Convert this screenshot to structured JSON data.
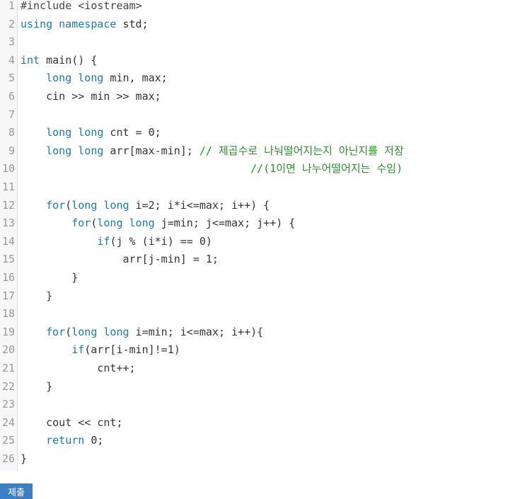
{
  "editor": {
    "lines": [
      {
        "n": "1",
        "segments": [
          {
            "t": "#include <iostream>",
            "c": "sub"
          }
        ]
      },
      {
        "n": "2",
        "segments": [
          {
            "t": "using namespace",
            "c": "kw"
          },
          {
            "t": " std;",
            "c": ""
          }
        ]
      },
      {
        "n": "3",
        "segments": []
      },
      {
        "n": "4",
        "segments": [
          {
            "t": "int",
            "c": "kw"
          },
          {
            "t": " main() {",
            "c": ""
          }
        ]
      },
      {
        "n": "5",
        "segments": [
          {
            "t": "    ",
            "c": ""
          },
          {
            "t": "long long",
            "c": "kw"
          },
          {
            "t": " min, max;",
            "c": ""
          }
        ]
      },
      {
        "n": "6",
        "segments": [
          {
            "t": "    cin >> min >> max;",
            "c": ""
          }
        ]
      },
      {
        "n": "7",
        "segments": []
      },
      {
        "n": "8",
        "segments": [
          {
            "t": "    ",
            "c": ""
          },
          {
            "t": "long long",
            "c": "kw"
          },
          {
            "t": " cnt = 0;",
            "c": ""
          }
        ]
      },
      {
        "n": "9",
        "segments": [
          {
            "t": "    ",
            "c": ""
          },
          {
            "t": "long long",
            "c": "kw"
          },
          {
            "t": " arr[max-min]; ",
            "c": ""
          },
          {
            "t": "// 제곱수로 나눠떨어지는지 아닌지를 저장",
            "c": "cm"
          }
        ]
      },
      {
        "n": "10",
        "segments": [
          {
            "t": "                                    ",
            "c": ""
          },
          {
            "t": "//(1이면 나누어떨어지는 수임)",
            "c": "cm"
          }
        ]
      },
      {
        "n": "11",
        "segments": []
      },
      {
        "n": "12",
        "segments": [
          {
            "t": "    ",
            "c": ""
          },
          {
            "t": "for",
            "c": "kw"
          },
          {
            "t": "(",
            "c": ""
          },
          {
            "t": "long long",
            "c": "kw"
          },
          {
            "t": " i=2; i*i<=max; i++) {",
            "c": ""
          }
        ]
      },
      {
        "n": "13",
        "segments": [
          {
            "t": "        ",
            "c": ""
          },
          {
            "t": "for",
            "c": "kw"
          },
          {
            "t": "(",
            "c": ""
          },
          {
            "t": "long long",
            "c": "kw"
          },
          {
            "t": " j=min; j<=max; j++) {",
            "c": ""
          }
        ]
      },
      {
        "n": "14",
        "segments": [
          {
            "t": "            ",
            "c": ""
          },
          {
            "t": "if",
            "c": "kw"
          },
          {
            "t": "(j % (i*i) == 0)",
            "c": ""
          }
        ]
      },
      {
        "n": "15",
        "segments": [
          {
            "t": "                arr[j-min] = 1;",
            "c": ""
          }
        ]
      },
      {
        "n": "16",
        "segments": [
          {
            "t": "        }",
            "c": ""
          }
        ]
      },
      {
        "n": "17",
        "segments": [
          {
            "t": "    }",
            "c": ""
          }
        ]
      },
      {
        "n": "18",
        "segments": []
      },
      {
        "n": "19",
        "segments": [
          {
            "t": "    ",
            "c": ""
          },
          {
            "t": "for",
            "c": "kw"
          },
          {
            "t": "(",
            "c": ""
          },
          {
            "t": "long long",
            "c": "kw"
          },
          {
            "t": " i=min; i<=max; i++){",
            "c": ""
          }
        ]
      },
      {
        "n": "20",
        "segments": [
          {
            "t": "        ",
            "c": ""
          },
          {
            "t": "if",
            "c": "kw"
          },
          {
            "t": "(arr[i-min]!=1)",
            "c": ""
          }
        ]
      },
      {
        "n": "21",
        "segments": [
          {
            "t": "            cnt++;",
            "c": ""
          }
        ]
      },
      {
        "n": "22",
        "segments": [
          {
            "t": "    }",
            "c": ""
          }
        ]
      },
      {
        "n": "23",
        "segments": []
      },
      {
        "n": "24",
        "segments": [
          {
            "t": "    cout << cnt;",
            "c": ""
          }
        ]
      },
      {
        "n": "25",
        "segments": [
          {
            "t": "    ",
            "c": ""
          },
          {
            "t": "return",
            "c": "kw"
          },
          {
            "t": " 0;",
            "c": ""
          }
        ]
      },
      {
        "n": "26",
        "segments": [
          {
            "t": "}",
            "c": ""
          }
        ]
      }
    ]
  },
  "submit": {
    "label": "제출"
  },
  "colors": {
    "keyword": "#1a7ab0",
    "comment": "#2e8b2e",
    "button": "#3d7fc6"
  }
}
